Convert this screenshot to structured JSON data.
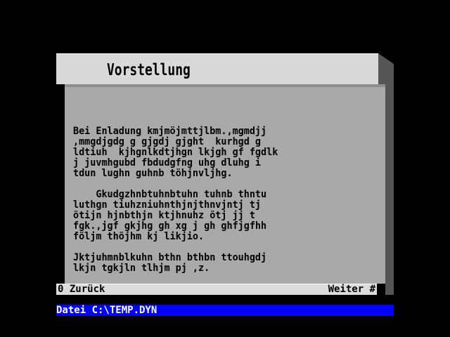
{
  "window": {
    "title": "Vorstellung"
  },
  "content": {
    "paragraphs": [
      "Bei Enladung kmjmöjmttjlbm.,mgmdjj\n,mmgdjgdg g gjgdj gjght  kurhgd g\nldtiuh  kjhgnlkdtjhgn lkjgh gf fgdlk\nj juvmhgubd fbdudgfng uhg dluhg i\ntdun lughn guhnb töhjnvljhg.",
      "    Gkudgzhnbtuhnbtuhn tuhnb thntu\nluthgn tiuhzniuhnthjnjthnvjntj tj\nötijn hjnbthjn ktjhnuhz ötj jj t\nfgk.,jgf gkjhg gh xg j gh ghfjgfhh\nföljm thöjhm kj likjio.",
      "Jktjuhmnblkuhn bthn bthbn ttouhgdj\nlkjn tgkjln tlhjm pj ,z."
    ]
  },
  "footer": {
    "back_label": "0 Zurück",
    "next_label": "Weiter #"
  },
  "status": {
    "text": "Datei C:\\TEMP.DYN"
  },
  "colors": {
    "background": "#000000",
    "title_bar": "#d9d9d9",
    "content_panel": "#a9a9a9",
    "shadow": "#555555",
    "status_bar": "#0000ff",
    "status_text": "#ffffff"
  }
}
